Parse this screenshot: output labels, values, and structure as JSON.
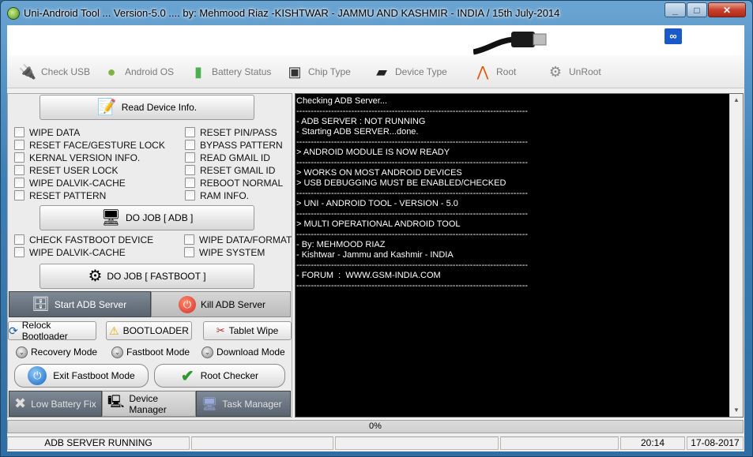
{
  "window": {
    "title": "Uni-Android Tool ... Version-5.0 .... by: Mehmood Riaz -KISHTWAR - JAMMU AND KASHMIR - INDIA   / 15th July-2014"
  },
  "toolbar": {
    "items": [
      {
        "label": "Check USB",
        "icon": "usb-plug-icon"
      },
      {
        "label": "Android OS",
        "icon": "android-icon"
      },
      {
        "label": "Battery Status",
        "icon": "battery-icon"
      },
      {
        "label": "Chip Type",
        "icon": "chip-icon"
      },
      {
        "label": "Device Type",
        "icon": "phone-icon"
      },
      {
        "label": "Root",
        "icon": "compass-icon"
      },
      {
        "label": "UnRoot",
        "icon": "gear-icon"
      }
    ]
  },
  "left": {
    "read_device_info": "Read Device Info.",
    "adb_options": {
      "col1": [
        "WIPE DATA",
        "RESET FACE/GESTURE LOCK",
        "KERNAL VERSION INFO.",
        "RESET USER LOCK",
        "WIPE DALVIK-CACHE",
        "RESET PATTERN"
      ],
      "col2": [
        "RESET PIN/PASS",
        "BYPASS PATTERN",
        "READ GMAIL ID",
        "RESET GMAIL ID",
        "REBOOT NORMAL",
        "RAM INFO."
      ]
    },
    "do_job_adb": "DO JOB [ ADB ]",
    "fastboot_options": {
      "col1": [
        "CHECK FASTBOOT DEVICE",
        "WIPE DALVIK-CACHE"
      ],
      "col2": [
        "WIPE DATA/FORMAT",
        "WIPE SYSTEM"
      ]
    },
    "do_job_fastboot": "DO JOB [ FASTBOOT ]",
    "start_adb": "Start ADB Server",
    "kill_adb": "Kill ADB Server",
    "relock_bootloader": "Relock Bootloader",
    "bootloader": "BOOTLOADER",
    "tablet_wipe": "Tablet Wipe",
    "recovery_mode": "Recovery Mode",
    "fastboot_mode": "Fastboot Mode",
    "download_mode": "Download Mode",
    "exit_fastboot": "Exit Fastboot Mode",
    "root_checker": "Root Checker",
    "low_battery_fix": "Low Battery Fix",
    "device_manager": "Device Manager",
    "task_manager": "Task Manager"
  },
  "console": {
    "text": "Checking ADB Server...\n--------------------------------------------------------------------------------\n- ADB SERVER : NOT RUNNING\n- Starting ADB SERVER...done.\n--------------------------------------------------------------------------------\n> ANDROID MODULE IS NOW READY\n--------------------------------------------------------------------------------\n> WORKS ON MOST ANDROID DEVICES\n> USB DEBUGGING MUST BE ENABLED/CHECKED\n--------------------------------------------------------------------------------\n> UNI - ANDROID TOOL - VERSION - 5.0\n--------------------------------------------------------------------------------\n> MULTI OPERATIONAL ANDROID TOOL\n--------------------------------------------------------------------------------\n- By: MEHMOOD RIAZ\n- Kishtwar - Jammu and Kashmir - INDIA\n--------------------------------------------------------------------------------\n- FORUM  :  WWW.GSM-INDIA.COM\n--------------------------------------------------------------------------------"
  },
  "progress": {
    "value": 0,
    "label": "0%"
  },
  "status": {
    "message": "ADB SERVER RUNNING",
    "time": "20:14",
    "date": "17-08-2017"
  }
}
